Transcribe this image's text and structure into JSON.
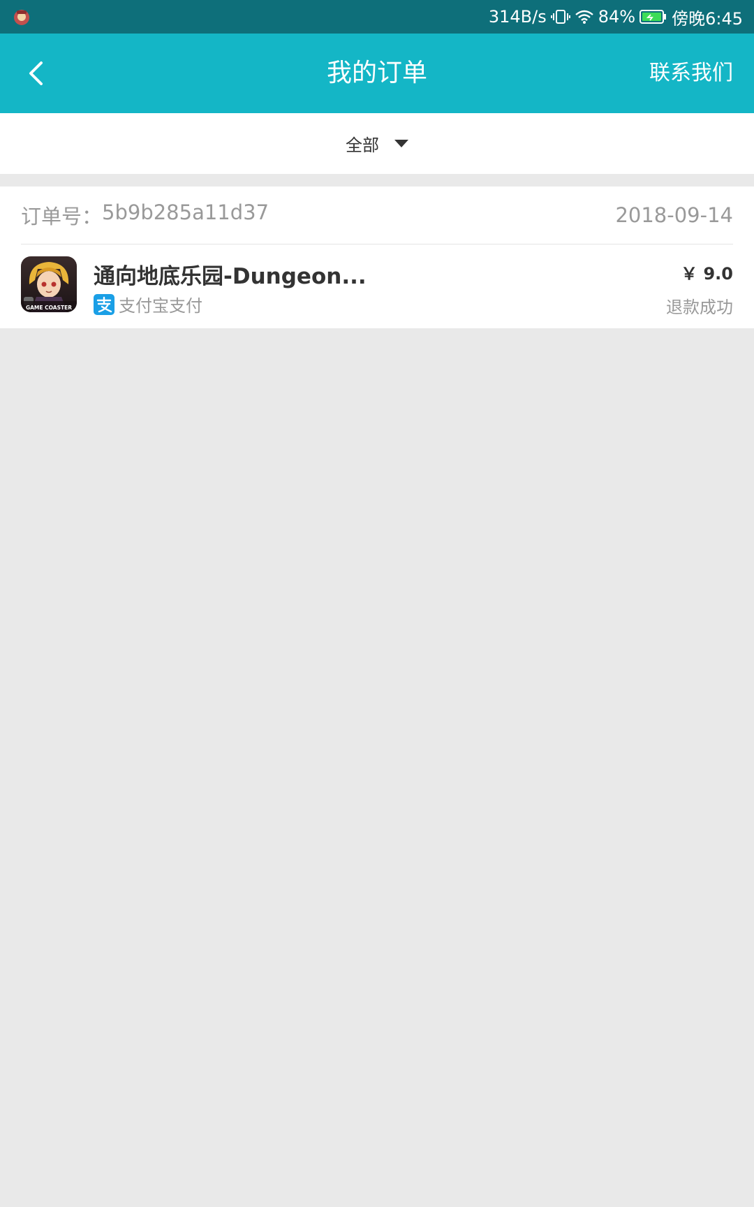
{
  "status_bar": {
    "net_speed": "314B/s",
    "battery": "84%",
    "time": "傍晚6:45",
    "icons": [
      "app-notification-icon",
      "vibrate-icon",
      "wifi-icon",
      "battery-charging-icon"
    ]
  },
  "header": {
    "title": "我的订单",
    "contact_label": "联系我们",
    "background_color": "#14b6c6"
  },
  "filter": {
    "selected": "全部"
  },
  "orders": [
    {
      "order_no_label": "订单号：",
      "order_no": "5b9b285a11d37",
      "date": "2018-09-14",
      "game_title": "通向地底乐园-Dungeon...",
      "icon_caption": "GAME COASTER",
      "payment_method": "支付宝支付",
      "price": "￥ 9.0",
      "status": "退款成功"
    }
  ],
  "colors": {
    "status_bar": "#0e6f7a",
    "page_background": "#e9e9e9",
    "alipay_blue": "#1a9fe6",
    "muted_text": "#999999"
  }
}
